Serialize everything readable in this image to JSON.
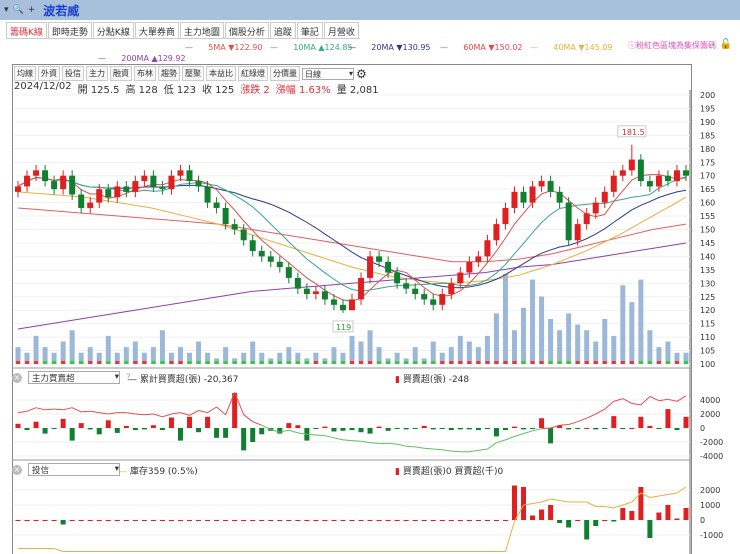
{
  "topbar": {
    "symbol": "波若威"
  },
  "tabs": [
    "籌碼K線",
    "即時走勢",
    "分點K線",
    "大單券商",
    "主力地圖",
    "個股分析",
    "追蹤",
    "筆記",
    "月營收"
  ],
  "ma_legend": [
    {
      "label": "5MA ▼122.90",
      "color": "#d9534f"
    },
    {
      "label": "10MA ▲124.85",
      "color": "#3aa88a"
    },
    {
      "label": "20MA ▼130.95",
      "color": "#2b3a8c"
    },
    {
      "label": "60MA ▼150.02",
      "color": "#e04a4a"
    },
    {
      "label": "40MA ▼145.09",
      "color": "#e8b040"
    },
    {
      "label": "200MA ▲129.92",
      "color": "#9040b0"
    }
  ],
  "note": "ⓘ粉紅色區塊為集保籌碼",
  "toolbar": {
    "buttons": [
      "均線",
      "外資",
      "投信",
      "主力",
      "融資",
      "布林",
      "趨勢",
      "壓聚",
      "本益比",
      "紅綠燈",
      "分價量"
    ],
    "period": "日線"
  },
  "info": {
    "date": "2024/12/02",
    "open": "開 125.5",
    "high": "高 128",
    "low": "低 123",
    "close": "收 125",
    "change": "漲跌 2",
    "pct": "漲幅 1.63%",
    "volume": "量 2,081"
  },
  "chart_data": [
    {
      "type": "candlestick",
      "y_ticks": [
        200,
        195,
        190,
        185,
        180,
        175,
        170,
        165,
        160,
        155,
        150,
        145,
        140,
        135,
        130,
        125,
        120,
        115,
        110,
        105,
        100
      ],
      "ylim": [
        100,
        200
      ],
      "annotations": {
        "high_label": "181.5",
        "low_label": "119"
      },
      "open": [
        164,
        166,
        170,
        172,
        168,
        165,
        170,
        163,
        158,
        160,
        165,
        162,
        166,
        164,
        168,
        170,
        166,
        165,
        170,
        172,
        168,
        166,
        160,
        158,
        152,
        150,
        146,
        142,
        140,
        138,
        136,
        132,
        128,
        126,
        127,
        124,
        122,
        120,
        124,
        132,
        140,
        138,
        134,
        130,
        128,
        126,
        124,
        122,
        126,
        130,
        134,
        138,
        140,
        146,
        152,
        158,
        164,
        160,
        166,
        168,
        164,
        160,
        146,
        152,
        156,
        160,
        164,
        170,
        172,
        176,
        168,
        166,
        170,
        168,
        172
      ],
      "high": [
        168,
        172,
        174,
        174,
        170,
        172,
        172,
        165,
        162,
        167,
        167,
        168,
        168,
        170,
        172,
        172,
        168,
        172,
        174,
        174,
        170,
        168,
        162,
        160,
        154,
        152,
        148,
        144,
        142,
        140,
        138,
        134,
        130,
        129,
        129,
        126,
        124,
        126,
        134,
        142,
        142,
        140,
        136,
        132,
        130,
        128,
        126,
        128,
        132,
        136,
        140,
        142,
        148,
        154,
        160,
        166,
        166,
        168,
        170,
        170,
        166,
        162,
        154,
        158,
        162,
        166,
        172,
        174,
        181.5,
        178,
        170,
        172,
        172,
        174,
        174
      ],
      "low": [
        162,
        164,
        168,
        166,
        163,
        163,
        161,
        156,
        156,
        158,
        160,
        160,
        162,
        162,
        166,
        164,
        163,
        163,
        168,
        166,
        164,
        158,
        156,
        150,
        148,
        144,
        140,
        138,
        136,
        134,
        130,
        126,
        124,
        124,
        122,
        120,
        119,
        120,
        122,
        130,
        136,
        132,
        128,
        126,
        124,
        122,
        120,
        120,
        124,
        128,
        132,
        136,
        138,
        144,
        150,
        156,
        158,
        158,
        164,
        162,
        158,
        144,
        144,
        150,
        154,
        158,
        162,
        168,
        170,
        166,
        164,
        164,
        166,
        166,
        168
      ],
      "close": [
        166,
        170,
        172,
        168,
        165,
        170,
        163,
        158,
        160,
        165,
        162,
        166,
        164,
        168,
        170,
        166,
        165,
        170,
        172,
        168,
        166,
        160,
        158,
        152,
        150,
        146,
        142,
        140,
        138,
        136,
        132,
        128,
        126,
        127,
        124,
        122,
        120,
        124,
        132,
        140,
        138,
        134,
        130,
        128,
        126,
        124,
        122,
        126,
        130,
        134,
        138,
        140,
        146,
        152,
        158,
        164,
        160,
        166,
        168,
        164,
        160,
        146,
        152,
        156,
        160,
        164,
        170,
        172,
        176,
        168,
        166,
        170,
        168,
        172,
        170
      ],
      "volume": [
        3,
        2,
        5,
        3,
        2,
        4,
        6,
        2,
        3,
        2,
        5,
        2,
        3,
        4,
        2,
        3,
        6,
        2,
        3,
        2,
        4,
        2,
        1,
        3,
        1,
        2,
        4,
        2,
        1,
        2,
        3,
        2,
        1,
        2,
        1,
        3,
        2,
        5,
        4,
        6,
        3,
        1,
        2,
        1,
        3,
        1,
        4,
        2,
        3,
        5,
        4,
        3,
        5,
        9,
        16,
        6,
        10,
        15,
        12,
        8,
        6,
        9,
        7,
        6,
        4,
        8,
        5,
        14,
        11,
        15,
        6,
        3,
        4,
        2,
        2
      ],
      "ma60": [
        158,
        157,
        156,
        155,
        154,
        153,
        152,
        150,
        148,
        146,
        144,
        142,
        140,
        138,
        138,
        139,
        141,
        144,
        147,
        150,
        152
      ],
      "ma40": [
        164,
        163,
        162,
        160,
        158,
        155,
        152,
        148,
        144,
        140,
        136,
        133,
        131,
        130,
        131,
        133,
        137,
        142,
        148,
        155,
        162
      ],
      "ma200": [
        113,
        115,
        117,
        119,
        121,
        123,
        125,
        127,
        128,
        129,
        130,
        131,
        132,
        133,
        134,
        136,
        137,
        139,
        141,
        143,
        145
      ]
    },
    {
      "type": "bar+line",
      "panel": "主力買賣超",
      "cum_label": "累計買賣超(張) -20,367",
      "bar_label": "買賣超(張) -248",
      "y_ticks": [
        4000,
        2000,
        0,
        -2000,
        -4000
      ],
      "bars": [
        600,
        -300,
        900,
        -800,
        -100,
        1300,
        -1800,
        700,
        -200,
        -900,
        1100,
        -700,
        300,
        -300,
        -200,
        400,
        -300,
        1500,
        -1800,
        1600,
        -600,
        1600,
        -1400,
        -1400,
        5000,
        -3200,
        -2000,
        -900,
        -400,
        -800,
        700,
        400,
        -1800,
        -100,
        200,
        -500,
        -400,
        -300,
        -600,
        -800,
        200,
        -400,
        -100,
        -200,
        -100,
        300,
        -200,
        -100,
        -300,
        -200,
        -200,
        -300,
        -100,
        -1200,
        -300,
        200,
        -200,
        -100,
        1400,
        -2200,
        400,
        -200,
        -100,
        0,
        -200,
        -100,
        1700,
        -100,
        0,
        1600,
        300,
        -100,
        2700,
        -300,
        1600
      ],
      "cum": [
        2200,
        2400,
        2900,
        2600,
        2700,
        2600,
        2900,
        2300,
        2400,
        2200,
        2000,
        2200,
        2200,
        2000,
        1900,
        2000,
        1600,
        2000,
        2200,
        1800,
        2500,
        2200,
        3000,
        1900,
        5100,
        1900,
        900,
        400,
        -200,
        -600,
        -300,
        -700,
        -900,
        -1000,
        -1100,
        -1400,
        -1700,
        -1800,
        -1900,
        -2100,
        -2200,
        -2200,
        -2300,
        -2600,
        -2700,
        -2900,
        -3000,
        -3100,
        -3300,
        -3400,
        -3400,
        -3200,
        -3000,
        -2100,
        -1700,
        -1200,
        -800,
        -400,
        -100,
        0,
        400,
        500,
        900,
        1400,
        2000,
        2700,
        3800,
        4200,
        3500,
        3300,
        4500,
        3900,
        4100,
        3800,
        4600
      ]
    },
    {
      "type": "bar+line",
      "panel": "投信",
      "line_label": "庫存359 (0.5%)",
      "bar_label": "買賣超(張)0 買賣超(千)0",
      "y_ticks": [
        2000,
        1000,
        0,
        -1000
      ],
      "bars": [
        0,
        0,
        0,
        0,
        0,
        -300,
        0,
        0,
        0,
        0,
        0,
        0,
        0,
        0,
        0,
        0,
        0,
        0,
        0,
        0,
        0,
        0,
        0,
        0,
        0,
        0,
        0,
        0,
        0,
        0,
        0,
        0,
        0,
        0,
        0,
        0,
        0,
        0,
        0,
        0,
        0,
        0,
        0,
        0,
        0,
        0,
        0,
        0,
        0,
        0,
        0,
        0,
        0,
        0,
        0,
        2300,
        2200,
        300,
        700,
        1000,
        -200,
        -500,
        0,
        -1300,
        -400,
        0,
        -100,
        800,
        600,
        2200,
        -1200,
        500,
        1000,
        100,
        800
      ],
      "inventory": [
        -1900,
        -1900,
        -1900,
        -1900,
        -1900,
        -2100,
        -2100,
        -2100,
        -2100,
        -2100,
        -2100,
        -2100,
        -2100,
        -2100,
        -2100,
        -2100,
        -2100,
        -2100,
        -2100,
        -2100,
        -2100,
        -2100,
        -2100,
        -2100,
        -2100,
        -2100,
        -2100,
        -2100,
        -2100,
        -2100,
        -2100,
        -2100,
        -2100,
        -2100,
        -2100,
        -2100,
        -2100,
        -2100,
        -2100,
        -2100,
        -2100,
        -2100,
        -2100,
        -2100,
        -2100,
        -2100,
        -2100,
        -2100,
        -2100,
        -2100,
        -2100,
        -2100,
        -2100,
        -2100,
        -2100,
        -100,
        1000,
        1100,
        1200,
        1400,
        1300,
        1200,
        1200,
        1200,
        900,
        900,
        800,
        1000,
        1200,
        1800,
        1500,
        1600,
        1700,
        1800,
        2200
      ]
    }
  ]
}
